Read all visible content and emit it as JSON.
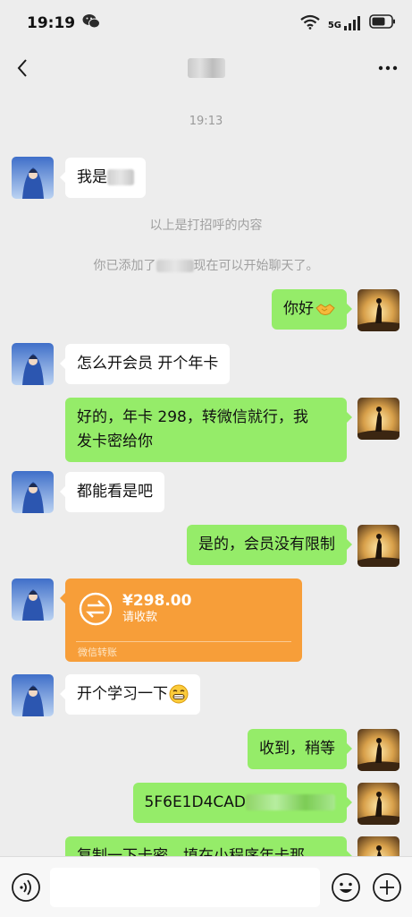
{
  "status_bar": {
    "time": "19:19",
    "icons": [
      "wechat-icon",
      "wifi-icon",
      "5g-signal-icon",
      "battery-icon"
    ],
    "wifi_badge": "6",
    "network_label": "5G"
  },
  "nav": {
    "back_icon": "chevron-left-icon",
    "title": "",
    "more_icon": "more-dots-icon"
  },
  "chat": {
    "timestamp": "19:13",
    "system_messages": [
      "以上是打招呼的内容",
      "你已添加了",
      "现在可以开始聊天了。"
    ],
    "messages": [
      {
        "side": "in",
        "text": "我是"
      },
      {
        "side": "out",
        "text": "你好"
      },
      {
        "side": "in",
        "text": "怎么开会员 开个年卡"
      },
      {
        "side": "out",
        "line1": "好的，年卡 298，转微信就行，我",
        "line2": "发卡密给你"
      },
      {
        "side": "in",
        "text": "都能看是吧"
      },
      {
        "side": "out",
        "text": "是的，会员没有限制"
      },
      {
        "side": "in",
        "type": "transfer"
      },
      {
        "side": "in",
        "text": "开个学习一下"
      },
      {
        "side": "out",
        "text": "收到，稍等"
      },
      {
        "side": "out",
        "text": "5F6E1D4CAD"
      },
      {
        "side": "out",
        "text": "复制一下卡密，填在小程序年卡那"
      }
    ],
    "transfer": {
      "amount": "¥298.00",
      "status": "请收款",
      "footer": "微信转账"
    }
  },
  "input_bar": {
    "voice_icon": "voice-icon",
    "emoji_icon": "emoji-icon",
    "plus_icon": "plus-icon"
  },
  "colors": {
    "background": "#ededed",
    "outgoing_bubble": "#95ec69",
    "incoming_bubble": "#ffffff",
    "transfer_card": "#f79e39"
  }
}
